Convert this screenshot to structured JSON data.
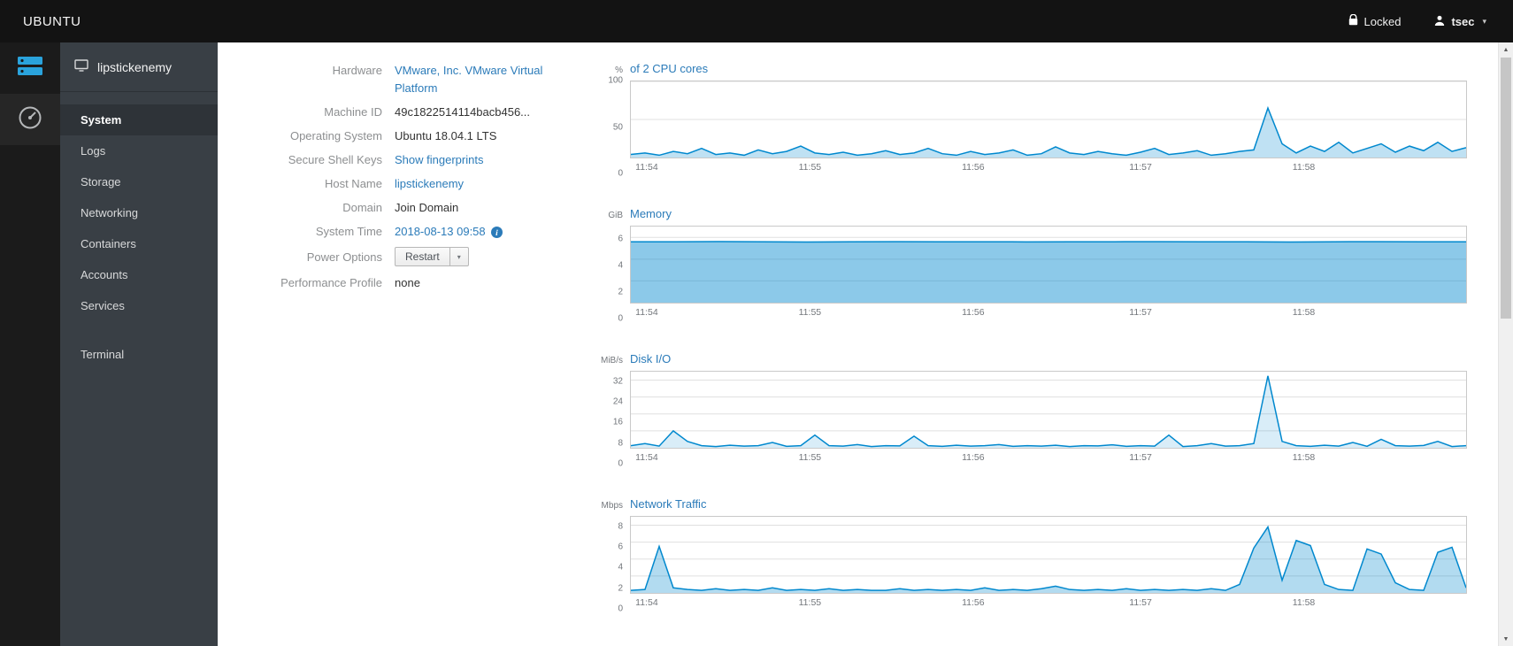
{
  "topbar": {
    "brand": "UBUNTU",
    "locked_label": "Locked",
    "user": "tsec"
  },
  "sidebar": {
    "host": "lipstickenemy",
    "items": [
      {
        "label": "System",
        "active": true
      },
      {
        "label": "Logs"
      },
      {
        "label": "Storage"
      },
      {
        "label": "Networking"
      },
      {
        "label": "Containers"
      },
      {
        "label": "Accounts"
      },
      {
        "label": "Services"
      },
      {
        "label": "Terminal"
      }
    ]
  },
  "details": {
    "hardware_label": "Hardware",
    "hardware_value": "VMware, Inc. VMware Virtual Platform",
    "machine_id_label": "Machine ID",
    "machine_id_value": "49c1822514114bacb456...",
    "os_label": "Operating System",
    "os_value": "Ubuntu 18.04.1 LTS",
    "ssh_label": "Secure Shell Keys",
    "ssh_value": "Show fingerprints",
    "hostname_label": "Host Name",
    "hostname_value": "lipstickenemy",
    "domain_label": "Domain",
    "domain_value": "Join Domain",
    "time_label": "System Time",
    "time_value": "2018-08-13 09:58",
    "power_label": "Power Options",
    "power_button": "Restart",
    "profile_label": "Performance Profile",
    "profile_value": "none"
  },
  "colors": {
    "accent": "#2b7bb9",
    "chart_line": "#0088ce",
    "sidenav_bg": "#393f45",
    "topbar_bg": "#131313"
  },
  "chart_data": [
    {
      "type": "area",
      "title": "of 2 CPU cores",
      "unit": "%",
      "ymax": 100,
      "yticks": [
        0,
        50,
        100
      ],
      "x_ticks": [
        "11:54",
        "11:55",
        "11:56",
        "11:57",
        "11:58"
      ],
      "x_tick_fracs": [
        0.02,
        0.215,
        0.41,
        0.61,
        0.805
      ],
      "color": "#0088ce",
      "fill_opacity": 0.25,
      "values": [
        4,
        6,
        3,
        8,
        5,
        12,
        4,
        6,
        3,
        10,
        5,
        8,
        15,
        6,
        4,
        7,
        3,
        5,
        9,
        4,
        6,
        12,
        5,
        3,
        8,
        4,
        6,
        10,
        3,
        5,
        14,
        6,
        4,
        8,
        5,
        3,
        7,
        12,
        4,
        6,
        9,
        3,
        5,
        8,
        10,
        65,
        18,
        6,
        15,
        8,
        20,
        6,
        12,
        18,
        7,
        15,
        9,
        20,
        8,
        13
      ]
    },
    {
      "type": "area",
      "title": "Memory",
      "unit": "GiB",
      "ymax": 7,
      "yticks": [
        0,
        2,
        4,
        6
      ],
      "x_ticks": [
        "11:54",
        "11:55",
        "11:56",
        "11:57",
        "11:58"
      ],
      "x_tick_fracs": [
        0.02,
        0.215,
        0.41,
        0.61,
        0.805
      ],
      "color": "#0088ce",
      "fill_opacity": 0.45,
      "values": [
        5.6,
        5.6,
        5.62,
        5.6,
        5.58,
        5.6,
        5.61,
        5.6,
        5.6,
        5.59,
        5.6,
        5.6,
        5.61,
        5.6,
        5.6,
        5.58,
        5.6,
        5.61,
        5.6,
        5.6
      ]
    },
    {
      "type": "area",
      "title": "Disk I/O",
      "unit": "MiB/s",
      "ymax": 36,
      "yticks": [
        0,
        8,
        16,
        24,
        32
      ],
      "x_ticks": [
        "11:54",
        "11:55",
        "11:56",
        "11:57",
        "11:58"
      ],
      "x_tick_fracs": [
        0.02,
        0.215,
        0.41,
        0.61,
        0.805
      ],
      "color": "#0088ce",
      "fill_opacity": 0.15,
      "values": [
        1,
        2,
        0.8,
        8,
        3,
        1,
        0.6,
        1.2,
        0.8,
        1,
        2.5,
        0.7,
        1,
        6,
        1,
        0.8,
        1.5,
        0.6,
        1,
        0.9,
        5.5,
        1,
        0.7,
        1.2,
        0.8,
        1,
        1.5,
        0.7,
        1,
        0.8,
        1.2,
        0.6,
        1,
        0.9,
        1.4,
        0.7,
        1,
        0.8,
        6,
        0.6,
        1,
        2,
        0.8,
        1,
        2,
        34,
        3,
        1,
        0.7,
        1.2,
        0.8,
        2.5,
        0.7,
        4,
        1,
        0.8,
        1.1,
        3,
        0.6,
        1
      ]
    },
    {
      "type": "area",
      "title": "Network Traffic",
      "unit": "Mbps",
      "ymax": 9,
      "yticks": [
        0,
        2,
        4,
        6,
        8
      ],
      "x_ticks": [
        "11:54",
        "11:55",
        "11:56",
        "11:57",
        "11:58"
      ],
      "x_tick_fracs": [
        0.02,
        0.215,
        0.41,
        0.61,
        0.805
      ],
      "color": "#0088ce",
      "fill_opacity": 0.3,
      "values": [
        0.3,
        0.4,
        5.5,
        0.6,
        0.4,
        0.3,
        0.5,
        0.3,
        0.4,
        0.3,
        0.6,
        0.3,
        0.4,
        0.3,
        0.5,
        0.3,
        0.4,
        0.3,
        0.3,
        0.5,
        0.3,
        0.4,
        0.3,
        0.4,
        0.3,
        0.6,
        0.3,
        0.4,
        0.3,
        0.5,
        0.8,
        0.4,
        0.3,
        0.4,
        0.3,
        0.5,
        0.3,
        0.4,
        0.3,
        0.4,
        0.3,
        0.5,
        0.3,
        1,
        5.3,
        7.8,
        1.5,
        6.2,
        5.6,
        1,
        0.4,
        0.3,
        5.2,
        4.6,
        1.2,
        0.4,
        0.3,
        4.8,
        5.4,
        0.6
      ]
    }
  ]
}
